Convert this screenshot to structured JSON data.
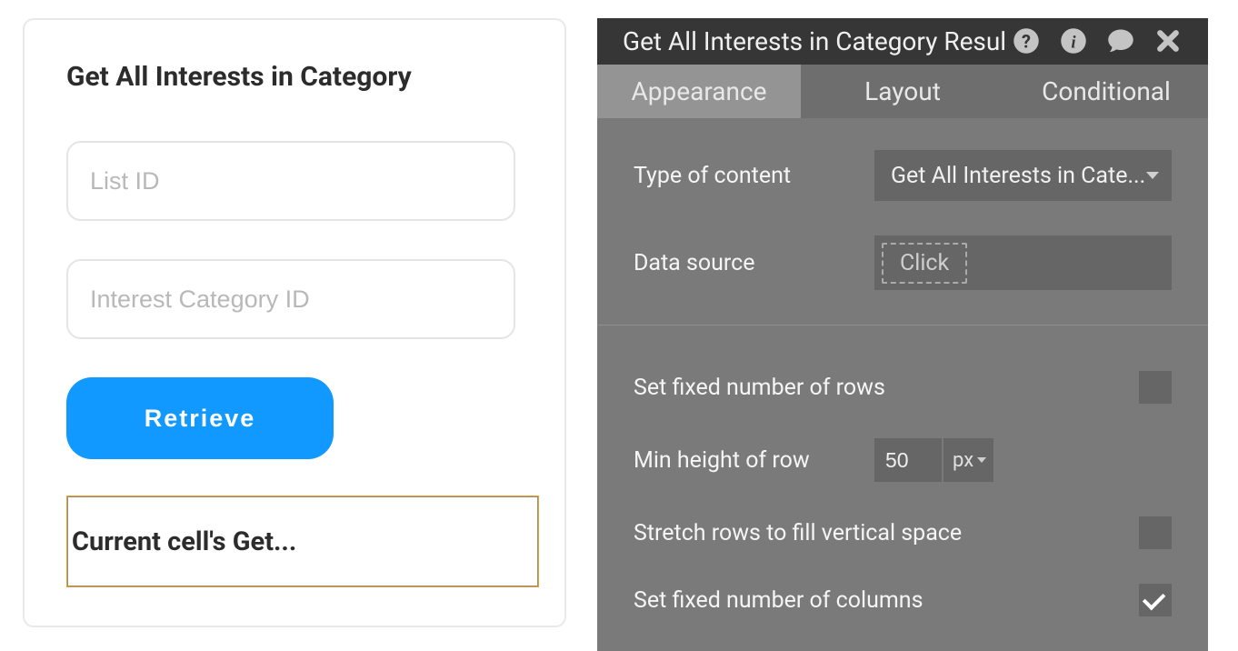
{
  "left": {
    "title": "Get All Interests in Category",
    "list_id_placeholder": "List ID",
    "interest_category_placeholder": "Interest Category ID",
    "retrieve_label": "Retrieve",
    "cell_text": "Current cell's Get..."
  },
  "panel": {
    "title": "Get All Interests in Category Resul",
    "tabs": {
      "appearance": "Appearance",
      "layout": "Layout",
      "conditional": "Conditional"
    },
    "type_of_content_label": "Type of content",
    "type_of_content_value": "Get All Interests in Cate...",
    "data_source_label": "Data source",
    "data_source_chip": "Click",
    "fixed_rows_label": "Set fixed number of rows",
    "min_height_label": "Min height of row",
    "min_height_value": "50",
    "min_height_unit": "px",
    "stretch_rows_label": "Stretch rows to fill vertical space",
    "fixed_columns_label": "Set fixed number of columns"
  }
}
